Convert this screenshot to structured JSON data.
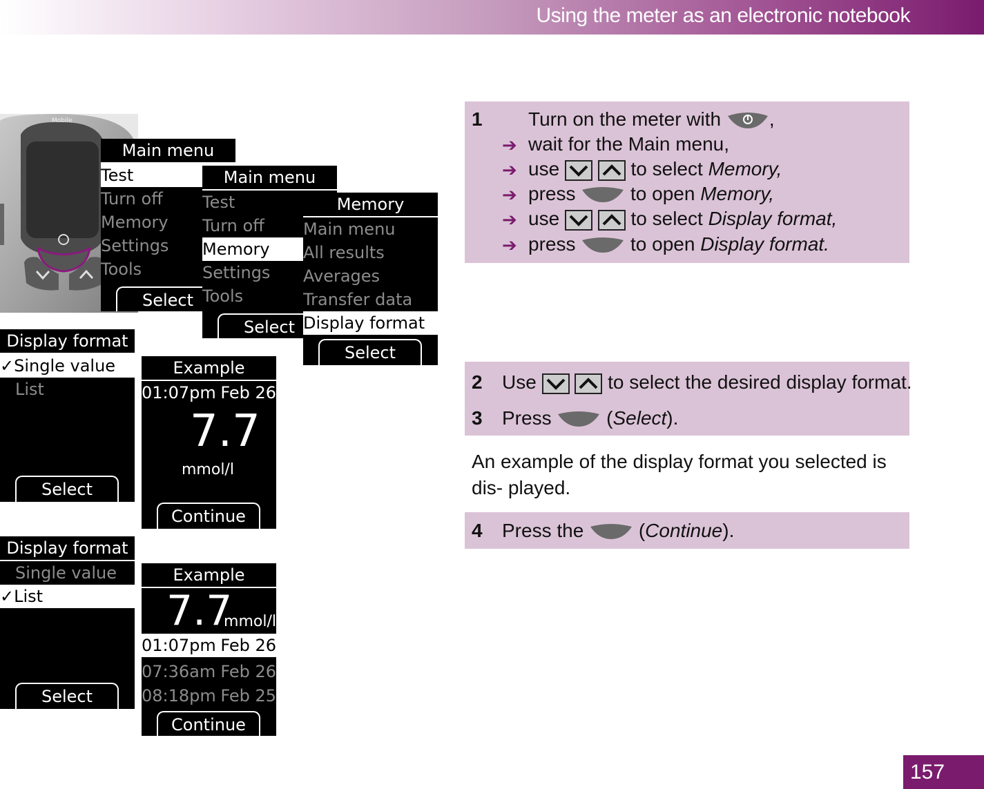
{
  "header": {
    "title": "Using the meter as an electronic notebook"
  },
  "page_number": "157",
  "meter": {
    "brand": "Mobile"
  },
  "screens": {
    "main1": {
      "title": "Main menu",
      "items": [
        "Test",
        "Turn off",
        "Memory",
        "Settings",
        "Tools"
      ],
      "button": "Select"
    },
    "main2": {
      "title": "Main menu",
      "items": [
        "Test",
        "Turn off",
        "Memory",
        "Settings",
        "Tools"
      ],
      "button": "Select"
    },
    "memory": {
      "title": "Memory",
      "items": [
        "Main menu",
        "All results",
        "Averages",
        "Transfer data",
        "Display format"
      ],
      "button": "Select"
    },
    "format1": {
      "title": "Display format",
      "items": [
        "✓Single value",
        "List"
      ],
      "button": "Select"
    },
    "example1": {
      "title": "Example",
      "time": "01:07pm",
      "date": "Feb 26",
      "value": "7.7",
      "unit": "mmol/l",
      "button": "Continue"
    },
    "format2": {
      "title": "Display format",
      "items": [
        "Single value",
        "✓List"
      ],
      "button": "Select"
    },
    "example2": {
      "title": "Example",
      "value": "7.7",
      "unit": "mmol/l",
      "rows": [
        {
          "time": "01:07pm",
          "date": "Feb 26"
        },
        {
          "time": "07:36am",
          "date": "Feb 26"
        },
        {
          "time": "08:18pm",
          "date": "Feb 25"
        }
      ],
      "button": "Continue"
    }
  },
  "step1": {
    "number": "1",
    "line1": "Turn on the meter with",
    "line1_end": ",",
    "line2": "wait for the Main menu,",
    "line3_a": "use",
    "line3_b": "to select",
    "line3_c": "Memory,",
    "line4_a": "press",
    "line4_b": "to open",
    "line4_c": "Memory,",
    "line5_a": "use",
    "line5_b": "to select",
    "line5_c": "Display format,",
    "line6_a": "press",
    "line6_b": "to open",
    "line6_c": "Display format."
  },
  "step2": {
    "number": "2",
    "a": "Use",
    "b": "to select the desired display format."
  },
  "step3": {
    "number": "3",
    "a": "Press",
    "b": "(",
    "c": "Select",
    "d": ")."
  },
  "paragraph": "An example of the display format you selected is dis- played.",
  "step4": {
    "number": "4",
    "a": "Press the",
    "b": "(",
    "c": "Continue",
    "d": ")."
  }
}
